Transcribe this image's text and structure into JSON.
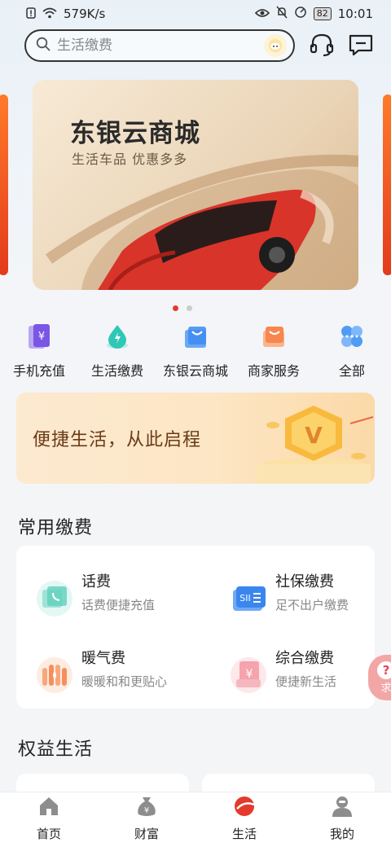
{
  "status_bar": {
    "speed": "579K/s",
    "battery": "82",
    "time": "10:01"
  },
  "search": {
    "placeholder": "生活缴费"
  },
  "banner": {
    "title": "东银云商城",
    "subtitle": "生活车品 优惠多多",
    "active_index": 0,
    "count": 2
  },
  "quick_menu": [
    {
      "label": "手机充值",
      "icon": "phone-recharge-icon"
    },
    {
      "label": "生活缴费",
      "icon": "water-drop-icon"
    },
    {
      "label": "东银云商城",
      "icon": "shopping-bag-icon"
    },
    {
      "label": "商家服务",
      "icon": "merchant-icon"
    },
    {
      "label": "全部",
      "icon": "all-apps-icon"
    }
  ],
  "promo": {
    "text": "便捷生活，从此启程"
  },
  "common_payments": {
    "title": "常用缴费",
    "items": [
      {
        "title": "话费",
        "subtitle": "话费便捷充值",
        "icon": "phone-bill-icon"
      },
      {
        "title": "社保缴费",
        "subtitle": "足不出户缴费",
        "icon": "social-security-icon"
      },
      {
        "title": "暖气费",
        "subtitle": "暖暖和和更贴心",
        "icon": "heating-icon"
      },
      {
        "title": "综合缴费",
        "subtitle": "便捷新生活",
        "icon": "general-payment-icon"
      }
    ]
  },
  "float_button": {
    "label": "求"
  },
  "benefits": {
    "title": "权益生活"
  },
  "tabbar": [
    {
      "label": "首页",
      "icon": "home-icon"
    },
    {
      "label": "财富",
      "icon": "wealth-icon"
    },
    {
      "label": "生活",
      "icon": "life-icon",
      "active": true
    },
    {
      "label": "我的",
      "icon": "profile-icon"
    }
  ],
  "colors": {
    "accent": "#e4392b",
    "promo_text": "#6a3a16"
  }
}
